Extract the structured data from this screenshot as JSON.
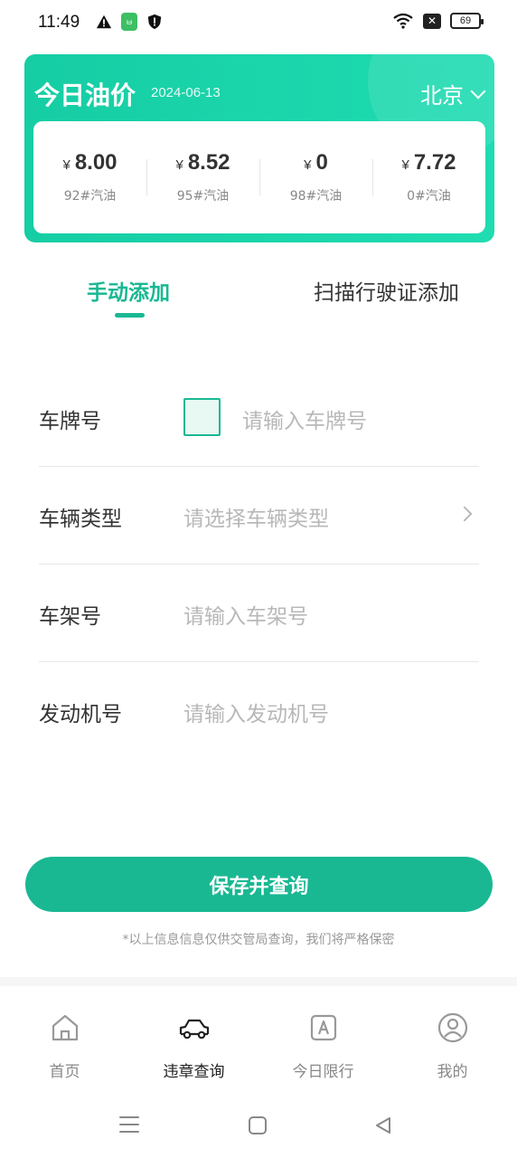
{
  "status_bar": {
    "time": "11:49",
    "app_badge": "ㅂ",
    "battery": "69",
    "close_badge": "✕"
  },
  "oil_price": {
    "title": "今日油价",
    "date": "2024-06-13",
    "city": "北京",
    "currency_symbol": "¥",
    "items": [
      {
        "price": "8.00",
        "type": "92#汽油"
      },
      {
        "price": "8.52",
        "type": "95#汽油"
      },
      {
        "price": "0",
        "type": "98#汽油"
      },
      {
        "price": "7.72",
        "type": "0#汽油"
      }
    ]
  },
  "tabs": {
    "manual": "手动添加",
    "scan": "扫描行驶证添加"
  },
  "form": {
    "plate_label": "车牌号",
    "plate_placeholder": "请输入车牌号",
    "vehicle_type_label": "车辆类型",
    "vehicle_type_placeholder": "请选择车辆类型",
    "vin_label": "车架号",
    "vin_placeholder": "请输入车架号",
    "engine_label": "发动机号",
    "engine_placeholder": "请输入发动机号"
  },
  "actions": {
    "save_label": "保存并查询",
    "privacy_note": "*以上信息信息仅供交管局查询，我们将严格保密"
  },
  "bottom_nav": {
    "items": [
      {
        "label": "首页",
        "icon": "home-icon"
      },
      {
        "label": "违章查询",
        "icon": "car-icon"
      },
      {
        "label": "今日限行",
        "icon": "restriction-icon"
      },
      {
        "label": "我的",
        "icon": "profile-icon"
      }
    ],
    "active_index": 1
  },
  "colors": {
    "accent": "#19b893",
    "card_gradient_start": "#16cda4",
    "card_gradient_end": "#1fdcb1"
  }
}
